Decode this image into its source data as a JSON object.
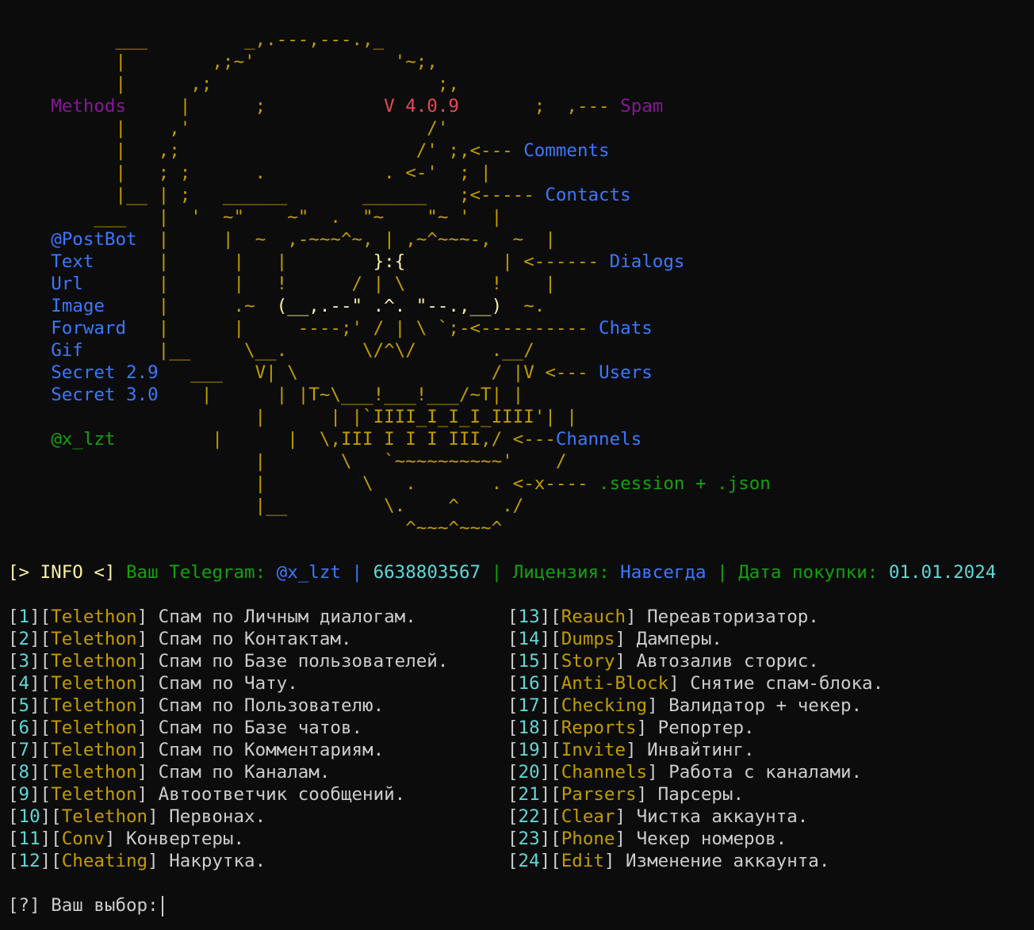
{
  "colors": {
    "background": "#0c0c0c",
    "art": "#c19c00",
    "art_bright": "#f9f1a5",
    "methods": "#881798",
    "links": "#3b78ff",
    "green": "#13a10e",
    "cyan": "#61d6d6",
    "red": "#e74856",
    "text": "#cccccc"
  },
  "banner": {
    "methods_label": "Methods",
    "version_prefix": "V",
    "version_number": "4.0.9",
    "arrows": {
      "spam": "Spam",
      "comments": "Comments",
      "contacts": "Contacts",
      "dialogs": "Dialogs",
      "chats": "Chats",
      "users": "Users",
      "channels": "Channels",
      "session": ".session + .json"
    },
    "left_items": {
      "postbot": "@PostBot",
      "text": "Text",
      "url": "Url",
      "image": "Image",
      "forward": "Forward",
      "gif": "Gif",
      "secret_29_label": "Secret",
      "secret_29_version": "2.9",
      "secret_30_label": "Secret",
      "secret_30_version": "3.0",
      "author": "@x_lzt"
    },
    "art_lines": [
      "          ___         _,.---,---.,_",
      "          |        ,;~'             '~;,",
      "          |      ,;                     ;,",
      "                                      ;  ,--- ",
      "          |    ,'                      /'",
      "          |   ,;                      /' ;,<--- ",
      "          |   ; ;      .           . <-'  ; |",
      "          |__ | ;   ______       ______   ;<----- ",
      "        ___   |  '  ~\"    ~\"  .  \"~    \"~ '  |",
      "              |  ~  ,-~~~^~, | ,~^~~~-,  ~  |",
      "               |   |        ",
      "               |   !      / | \\        !    |",
      "               .~  ",
      "               |     ----;' / | \\ `;-<---------- ",
      "                \\__.       \\/^\\/       .__/",
      "          ___   V| \\                  / |V <--- ",
      "           |      | |T~\\___!___!___/~T| |",
      "           |      | |`IIII_I_I_I_IIII'| |",
      "           |      |  \\,III I I I III,/ <---",
      "           |       \\   `~~~~~~~~~~'    /",
      "           |         \\   .       . <-x---- ",
      "           |__         \\.    ^    ./",
      "                         ^~~~^~~~^"
    ],
    "art_parts": {
      "line4_pre": "          |      ;",
      "line4_mid": "           ",
      "line4_post": "       ;  ,--- ",
      "line11_pre": "               |   |        ",
      "line11_mouth": "}:{",
      "line11_post": "         | <------ ",
      "line13_pre": "               .~  ",
      "line13_eyes": "(__,.--\" .^. \"--.,__)",
      "line13_post": "  ~.",
      "line17_post": "V <--- ",
      "line20_post": " <---"
    }
  },
  "info": {
    "tag": "[> INFO <]",
    "telegram_label": "Ваш Telegram:",
    "telegram_user": "@x_lzt",
    "separator": "|",
    "telegram_id": "6638803567",
    "license_label": "Лицензия:",
    "license_value": "Навсегда",
    "purchase_label": "Дата покупки:",
    "purchase_date": "01.01.2024"
  },
  "menu": {
    "left": [
      {
        "num": "1",
        "tag": "Telethon",
        "desc": "Спам по Личным диалогам."
      },
      {
        "num": "2",
        "tag": "Telethon",
        "desc": "Спам по Контактам."
      },
      {
        "num": "3",
        "tag": "Telethon",
        "desc": "Спам по Базе пользователей."
      },
      {
        "num": "4",
        "tag": "Telethon",
        "desc": "Спам по Чату."
      },
      {
        "num": "5",
        "tag": "Telethon",
        "desc": "Спам по Пользователю."
      },
      {
        "num": "6",
        "tag": "Telethon",
        "desc": "Спам по Базе чатов."
      },
      {
        "num": "7",
        "tag": "Telethon",
        "desc": "Спам по Комментариям."
      },
      {
        "num": "8",
        "tag": "Telethon",
        "desc": "Спам по Каналам."
      },
      {
        "num": "9",
        "tag": "Telethon",
        "desc": "Автоответчик сообщений."
      },
      {
        "num": "10",
        "tag": "Telethon",
        "desc": "Первонах."
      },
      {
        "num": "11",
        "tag": "Conv",
        "desc": "Конвертеры."
      },
      {
        "num": "12",
        "tag": "Cheating",
        "desc": "Накрутка."
      }
    ],
    "right": [
      {
        "num": "13",
        "tag": "Reauch",
        "desc": "Переавторизатор."
      },
      {
        "num": "14",
        "tag": "Dumps",
        "desc": "Дамперы."
      },
      {
        "num": "15",
        "tag": "Story",
        "desc": "Автозалив сторис."
      },
      {
        "num": "16",
        "tag": "Anti-Block",
        "desc": "Снятие спам-блока."
      },
      {
        "num": "17",
        "tag": "Checking",
        "desc": "Валидатор + чекер."
      },
      {
        "num": "18",
        "tag": "Reports",
        "desc": "Репортер."
      },
      {
        "num": "19",
        "tag": "Invite",
        "desc": "Инвайтинг."
      },
      {
        "num": "20",
        "tag": "Channels",
        "desc": "Работа с каналами."
      },
      {
        "num": "21",
        "tag": "Parsers",
        "desc": "Парсеры."
      },
      {
        "num": "22",
        "tag": "Clear",
        "desc": "Чистка аккаунта."
      },
      {
        "num": "23",
        "tag": "Phone",
        "desc": "Чекер номеров."
      },
      {
        "num": "24",
        "tag": "Edit",
        "desc": "Изменение аккаунта."
      }
    ]
  },
  "prompt": {
    "marker": "[?]",
    "text": "Ваш выбор:"
  }
}
